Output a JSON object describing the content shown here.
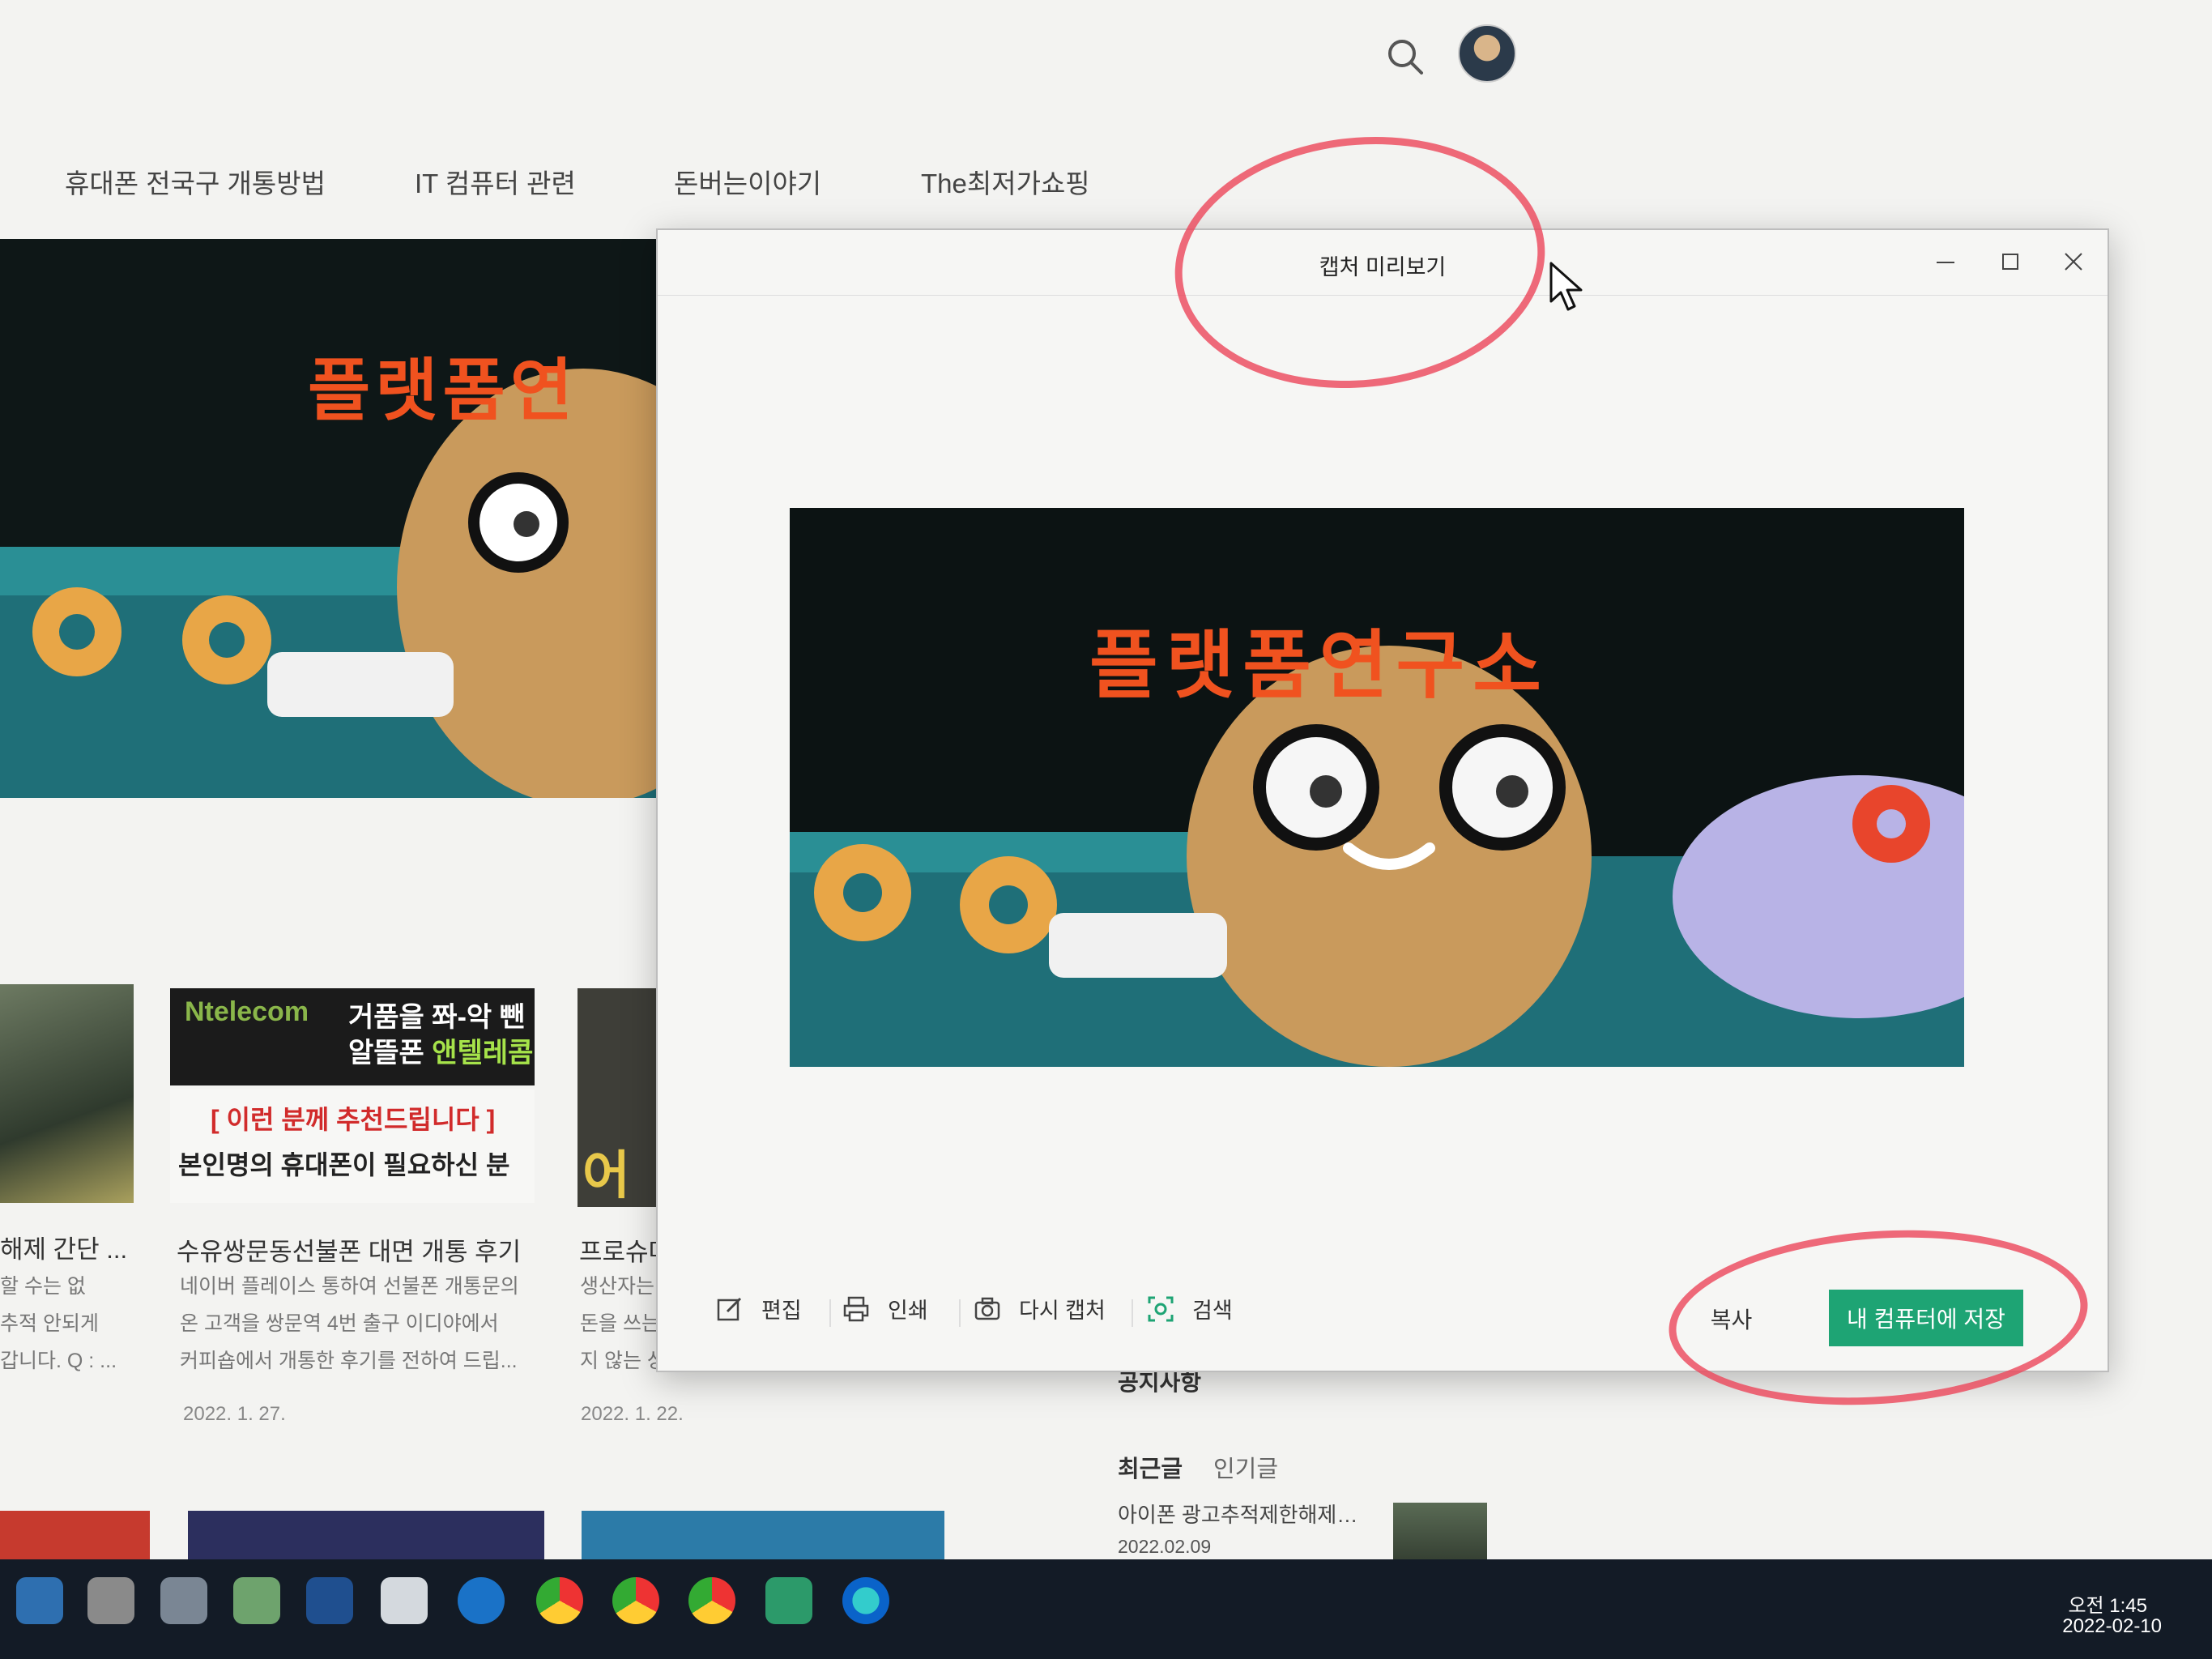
{
  "header": {
    "nav": [
      "휴대폰 전국구 개통방법",
      "IT 컴퓨터 관련",
      "돈버는이야기",
      "The최저가쇼핑"
    ]
  },
  "hero": {
    "title": "플랫폼연"
  },
  "cards": [
    {
      "title": "해제 간단 ...",
      "excerpt": [
        "할 수는 없",
        "추적 안되게",
        "갑니다. Q : ..."
      ]
    },
    {
      "thumb_brand": "Ntelecom",
      "thumb_line1": "거품을 쫘-악 뺀",
      "thumb_line2a": "알뜰폰 ",
      "thumb_line2b": "앤텔레콤",
      "thumb_rec": "[ 이런 분께 추천드립니다 ]",
      "thumb_rec2": "본인명의 휴대폰이 필요하신 분",
      "title": "수유쌍문동선불폰 대면 개통 후기",
      "excerpt": [
        "네이버 플레이스 통하여 선불폰 개통문의",
        "온 고객을 쌍문역 4번 출구 이디야에서",
        "커피숍에서 개통한 후기를 전하여 드립..."
      ],
      "date": "2022. 1. 27."
    },
    {
      "thumb_text": "어떻",
      "title": "프로슈머",
      "excerpt": [
        "생산자는 ",
        "돈을 쓰는 ",
        "지 않는 상식이었던 시기가 있었다. 산..."
      ],
      "date": "2022. 1. 22."
    }
  ],
  "sidebar": {
    "notice": "공지사항",
    "tab_recent": "최근글",
    "tab_popular": "인기글",
    "recent_title": "아이폰 광고추적제한해제…",
    "recent_date": "2022.02.09"
  },
  "dialog": {
    "title": "캡처 미리보기",
    "preview_title": "플랫폼연구소",
    "toolbar": {
      "edit": "편집",
      "print": "인쇄",
      "recapture": "다시 캡처",
      "search": "검색",
      "copy": "복사",
      "save": "내 컴퓨터에 저장"
    }
  },
  "taskbar": {
    "time": "오전 1:45",
    "date": "2022-02-10"
  },
  "colors": {
    "accent_green": "#1ea474",
    "brand_orange": "#f0521f",
    "annotation_red": "#ec465a"
  }
}
